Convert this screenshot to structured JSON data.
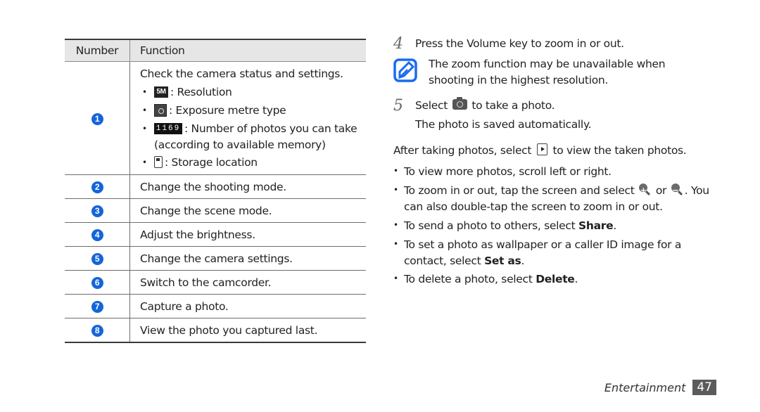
{
  "table": {
    "headers": {
      "number": "Number",
      "function": "Function"
    },
    "row1": {
      "badge": "1",
      "intro": "Check the camera status and settings.",
      "items": [
        {
          "icon": "resolution-icon",
          "icon_text": "5M",
          "label": ": Resolution"
        },
        {
          "icon": "exposure-metre-icon",
          "label": ": Exposure metre type"
        },
        {
          "icon": "photo-count-icon",
          "icon_text": "1169",
          "label": ": Number of photos you can take",
          "cont": "(according to available memory)"
        },
        {
          "icon": "storage-icon",
          "label": ": Storage location"
        }
      ]
    },
    "rows": [
      {
        "badge": "2",
        "text": "Change the shooting mode."
      },
      {
        "badge": "3",
        "text": "Change the scene mode."
      },
      {
        "badge": "4",
        "text": "Adjust the brightness."
      },
      {
        "badge": "5",
        "text": "Change the camera settings."
      },
      {
        "badge": "6",
        "text": "Switch to the camcorder."
      },
      {
        "badge": "7",
        "text": "Capture a photo."
      },
      {
        "badge": "8",
        "text": "View the photo you captured last."
      }
    ]
  },
  "steps": {
    "step4": {
      "num": "4",
      "text": "Press the Volume key to zoom in or out."
    },
    "note": {
      "line1": "The zoom function may be unavailable when",
      "line2": "shooting in the highest resolution."
    },
    "step5": {
      "num": "5",
      "pre": "Select",
      "post": "to take a photo.",
      "line2": "The photo is saved automatically."
    }
  },
  "after": {
    "pre": "After taking photos, select",
    "post": "to view the taken photos."
  },
  "bullets": {
    "b1": "To view more photos, scroll left or right.",
    "b2": {
      "pre": "To zoom in or out, tap the screen and select",
      "mid": "or",
      "post": ". You",
      "line2": "can also double-tap the screen to zoom in or out."
    },
    "b3": {
      "pre": "To send a photo to others, select",
      "bold": "Share",
      "post": "."
    },
    "b4": {
      "line1": "To set a photo as wallpaper or a caller ID image for a",
      "pre": "contact, select",
      "bold": "Set as",
      "post": "."
    },
    "b5": {
      "pre": "To delete a photo, select",
      "bold": "Delete",
      "post": "."
    }
  },
  "footer": {
    "section": "Entertainment",
    "page": "47"
  },
  "colors": {
    "badge": "#1565d8",
    "note_icon": "#1a6cf0",
    "header_bg": "#e6e6e6",
    "page_badge": "#5b5b5b"
  }
}
